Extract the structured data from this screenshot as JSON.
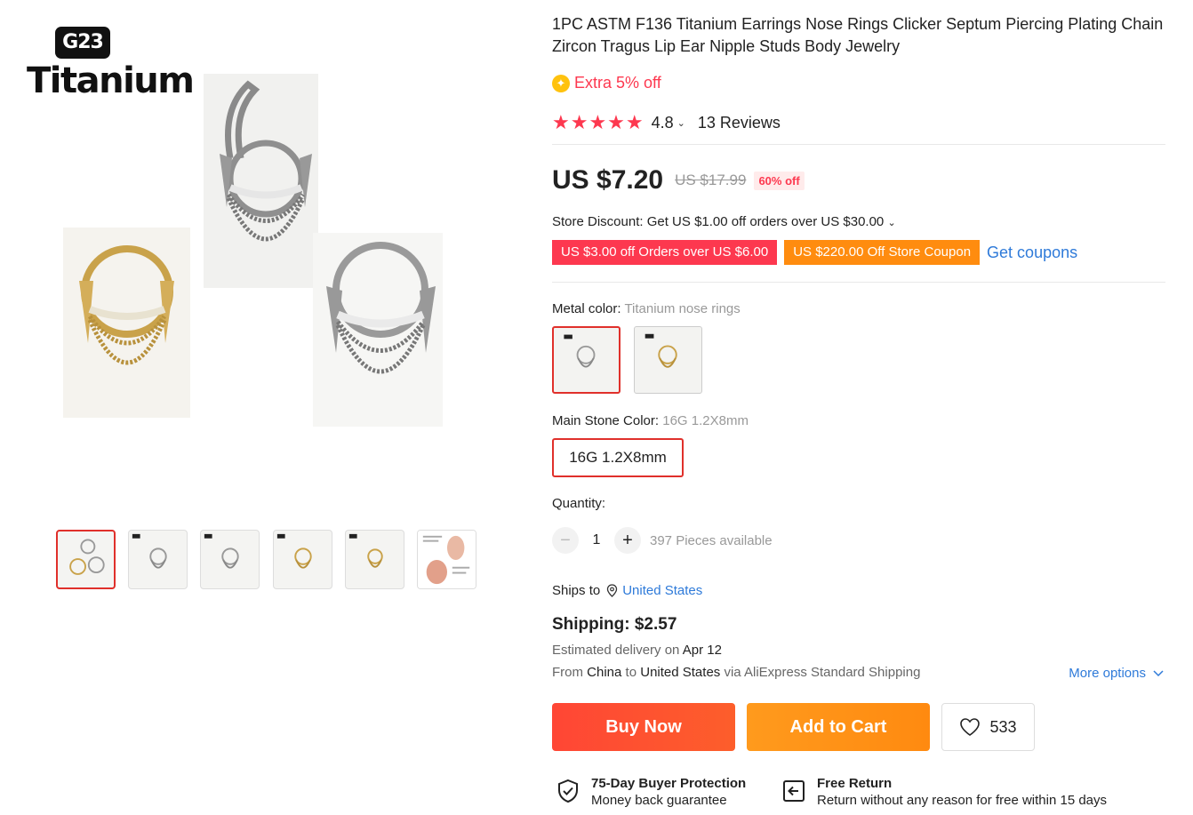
{
  "brand": {
    "badge": "G23",
    "word": "Titanium"
  },
  "gallery": {
    "thumbnails": [
      {
        "name": "thumb-main"
      },
      {
        "name": "thumb-silver-1"
      },
      {
        "name": "thumb-silver-2"
      },
      {
        "name": "thumb-gold-1"
      },
      {
        "name": "thumb-gold-2"
      },
      {
        "name": "thumb-diagram"
      }
    ],
    "colors": {
      "gold": "#c9a24a",
      "silver": "#8a8a8a"
    }
  },
  "product": {
    "title": "1PC ASTM F136 Titanium Earrings Nose Rings Clicker Septum Piercing Plating Chain Zircon Tragus Lip Ear Nipple Studs Body Jewelry",
    "promo": "Extra 5% off",
    "rating": {
      "stars": 5,
      "score": "4.8",
      "reviews": "13 Reviews"
    },
    "price": "US $7.20",
    "original_price": "US $17.99",
    "discount": "60% off",
    "store_discount": "Store Discount: Get US $1.00 off orders over US $30.00",
    "coupons": [
      "US $3.00 off Orders over US $6.00",
      "US $220.00 Off Store Coupon"
    ],
    "get_coupons": "Get coupons"
  },
  "options": {
    "metal_color": {
      "label": "Metal color: ",
      "selected": "Titanium nose rings"
    },
    "main_stone": {
      "label": "Main Stone Color: ",
      "selected": "16G 1.2X8mm",
      "button": "16G 1.2X8mm"
    }
  },
  "quantity": {
    "label": "Quantity:",
    "value": "1",
    "available": "397 Pieces available",
    "minus": "−",
    "plus": "+"
  },
  "shipping": {
    "ships_to_label": "Ships to",
    "country": "United States",
    "cost": "Shipping: $2.57",
    "delivery_prefix": "Estimated delivery on ",
    "delivery_date": "Apr 12",
    "route_from": "From ",
    "origin": "China",
    "route_to": " to ",
    "destination": "United States",
    "route_via": " via AliExpress Standard Shipping",
    "more_options": "More options"
  },
  "actions": {
    "buy_now": "Buy Now",
    "add_to_cart": "Add to Cart",
    "wishlist_count": "533"
  },
  "guarantees": [
    {
      "title": "75-Day Buyer Protection",
      "subtitle": "Money back guarantee"
    },
    {
      "title": "Free Return",
      "subtitle": "Return without any reason for free within 15 days"
    }
  ],
  "theme": {
    "accent_red": "#fd384f",
    "link_blue": "#2e7ad9",
    "orange": "#ff8c0f"
  }
}
